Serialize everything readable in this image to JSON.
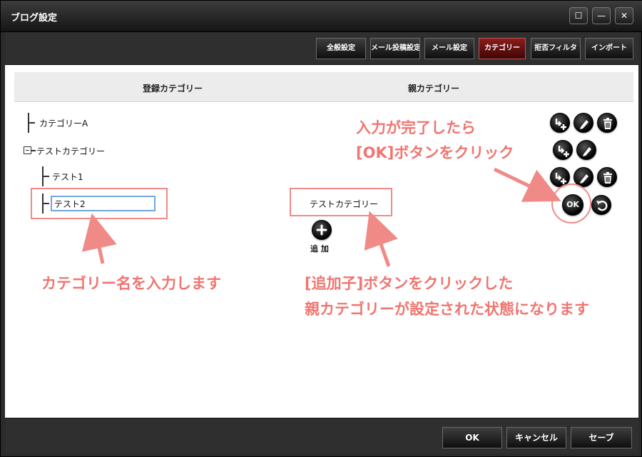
{
  "window": {
    "title": "ブログ設定",
    "maximize_glyph": "☐",
    "minimize_glyph": "—",
    "close_glyph": "✕"
  },
  "tabs": [
    {
      "label": "全般設定",
      "active": false
    },
    {
      "label": "メール投稿設定",
      "active": false
    },
    {
      "label": "メール設定",
      "active": false
    },
    {
      "label": "カテゴリー",
      "active": true
    },
    {
      "label": "拒否フィルタ",
      "active": false
    },
    {
      "label": "インポート",
      "active": false
    }
  ],
  "columns": {
    "registered": "登録カテゴリー",
    "parent": "親カテゴリー"
  },
  "tree": {
    "item_a": "カテゴリーA",
    "item_test_category": "テストカテゴリー",
    "item_test1": "テスト1",
    "input_value": "テスト2"
  },
  "parent_value": "テストカテゴリー",
  "add_label": "追 加",
  "annotations": {
    "enter_name": "カテゴリー名を入力します",
    "after_add_line1": "[追加子]ボタンをクリックした",
    "after_add_line2": "親カテゴリーが設定された状態になります",
    "click_ok_line1": "入力が完了したら",
    "click_ok_line2": "[OK]ボタンをクリック"
  },
  "ok_glyph": "OK",
  "footer": {
    "ok": "OK",
    "cancel": "キャンセル",
    "save": "セーブ"
  },
  "colors": {
    "annotation": "#f07570",
    "active_tab": "#8a1d1d",
    "input_border": "#6fa8dc"
  }
}
